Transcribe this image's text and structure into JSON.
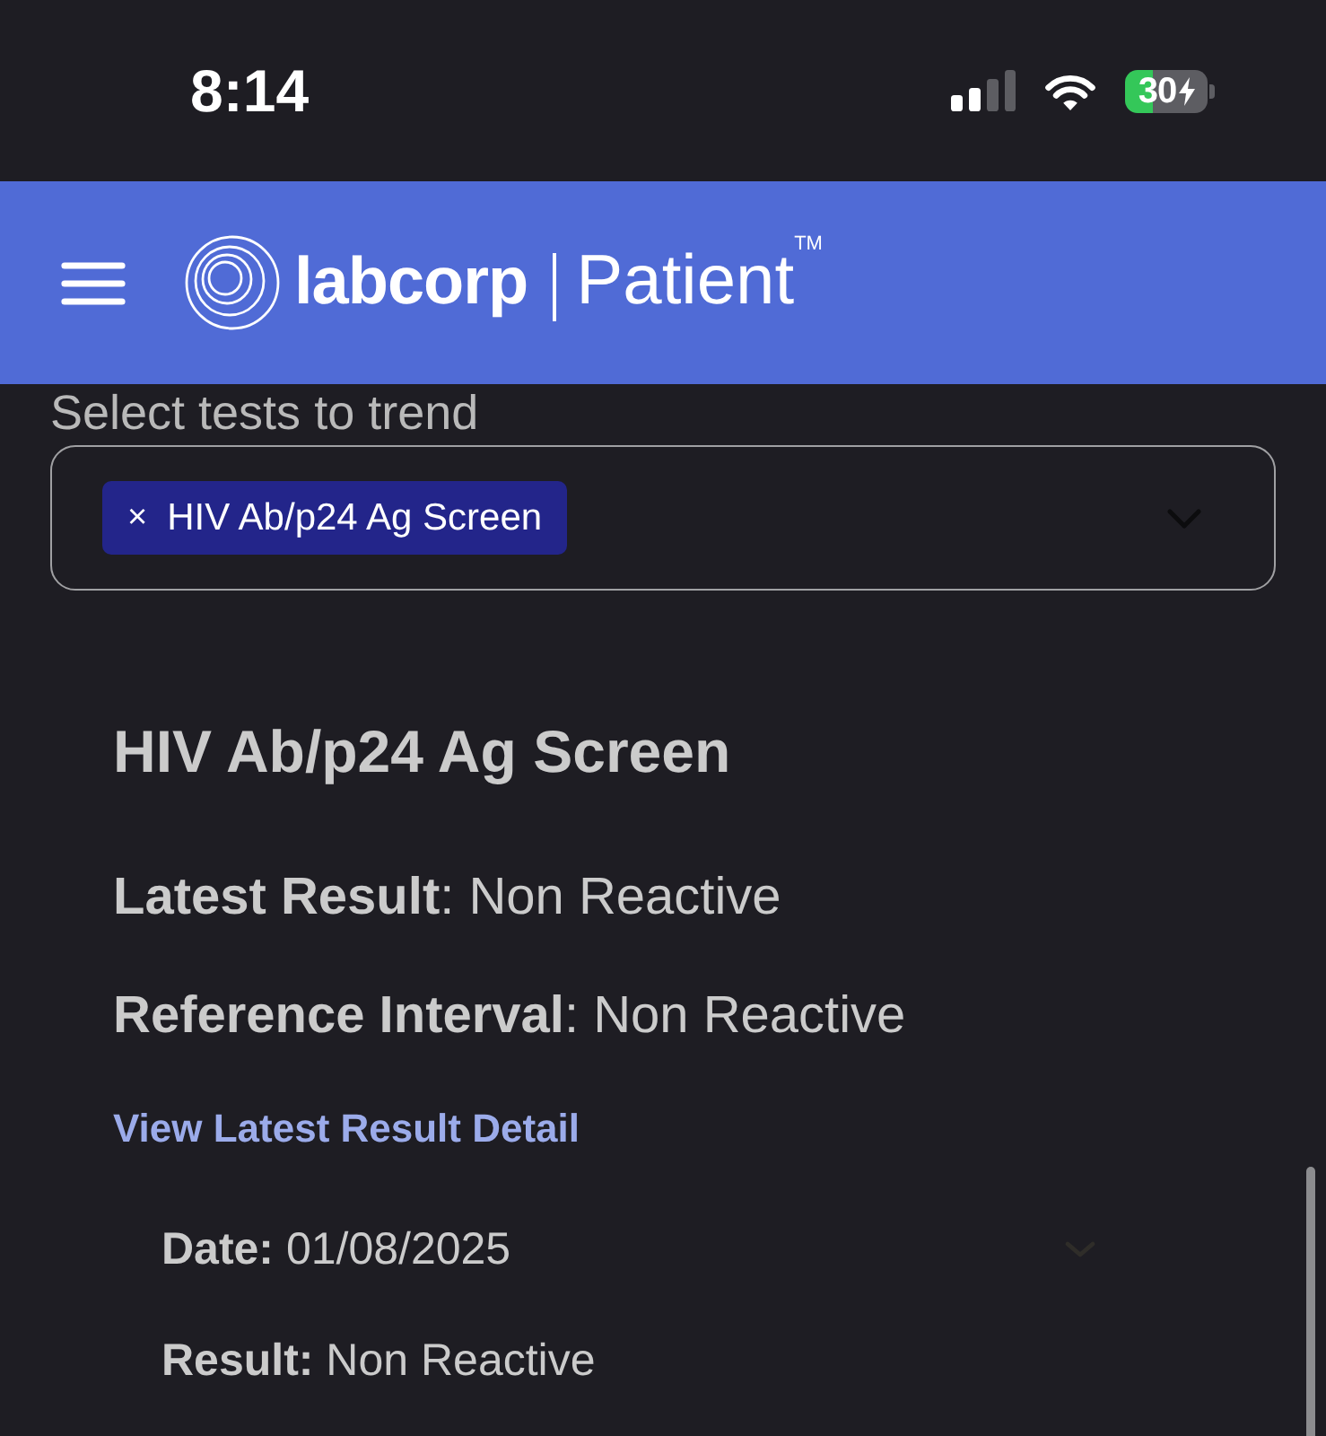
{
  "status_bar": {
    "time": "8:14",
    "battery": "30"
  },
  "header": {
    "brand": "labcorp",
    "product": "Patient",
    "trademark": "TM"
  },
  "test_selector": {
    "label": "Select tests to trend",
    "chips": [
      {
        "remove": "×",
        "label": "HIV Ab/p24 Ag Screen"
      }
    ]
  },
  "result": {
    "title": "HIV Ab/p24 Ag Screen",
    "summary": [
      "**Latest Result**: Non Reactive",
      "**Reference Interval**: Non Reactive"
    ],
    "link": "View Latest Result Detail",
    "history": [
      {
        "lines": [
          "**Date:** 01/08/2025",
          "**Result:** Non Reactive"
        ]
      }
    ]
  }
}
